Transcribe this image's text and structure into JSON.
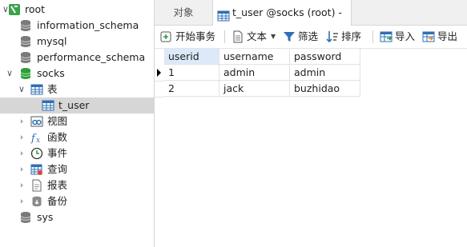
{
  "tree": {
    "root": "root",
    "databases": [
      "information_schema",
      "mysql",
      "performance_schema",
      "socks",
      "sys"
    ],
    "tables_folder": "表",
    "table": "t_user",
    "views": "视图",
    "functions": "函数",
    "events": "事件",
    "queries": "查询",
    "reports": "报表",
    "backups": "备份"
  },
  "tabs": {
    "objects": "对象",
    "current": "t_user @socks (root) - 表"
  },
  "toolbar": {
    "begin_transaction": "开始事务",
    "text": "文本",
    "filter": "筛选",
    "sort": "排序",
    "import": "导入",
    "export": "导出"
  },
  "grid": {
    "columns": [
      "userid",
      "username",
      "password"
    ],
    "rows": [
      [
        "1",
        "admin",
        "admin"
      ],
      [
        "2",
        "jack",
        "buzhidao"
      ]
    ]
  },
  "colors": {
    "db_icon": "#7a7a7a",
    "db_active": "#2e9e3a",
    "table_icon": "#2f6fb6",
    "selection": "#d6d6d6",
    "header_active": "#dce9f8"
  }
}
